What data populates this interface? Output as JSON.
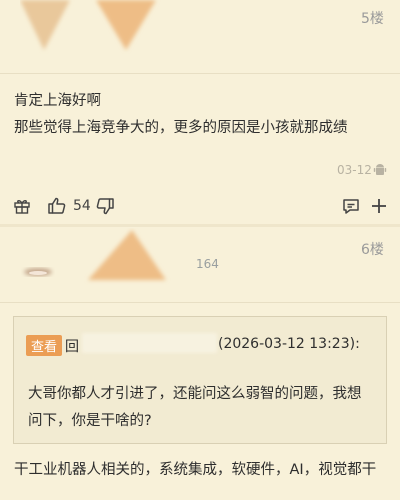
{
  "floor5": {
    "floor_label": "5楼",
    "lines": [
      "肯定上海好啊",
      "那些觉得上海竞争大的，更多的原因是小孩就那成绩"
    ],
    "date": "03-12",
    "like_count": "54"
  },
  "floor6": {
    "floor_label": "6楼",
    "user_level": "164",
    "quote": {
      "view_label": "查看",
      "reply_prefix": "回",
      "timestamp": "(2026-03-12 13:23):",
      "text_line1": "大哥你都人才引进了，还能问这么弱智的问题，我想",
      "text_line2": "问下，你是干啥的?"
    },
    "reply_text": "干工业机器人相关的，系统集成，软硬件，AI，视觉都干"
  },
  "colors": {
    "background": "#f8f1d9",
    "accent_orange": "#eb9d54",
    "text": "#2e2e2e",
    "muted": "#9a9a9a"
  },
  "icons": [
    "avatar-blurred",
    "android-icon",
    "gift-icon",
    "thumb-up-icon",
    "thumb-down-icon",
    "comment-icon",
    "plus-icon"
  ]
}
